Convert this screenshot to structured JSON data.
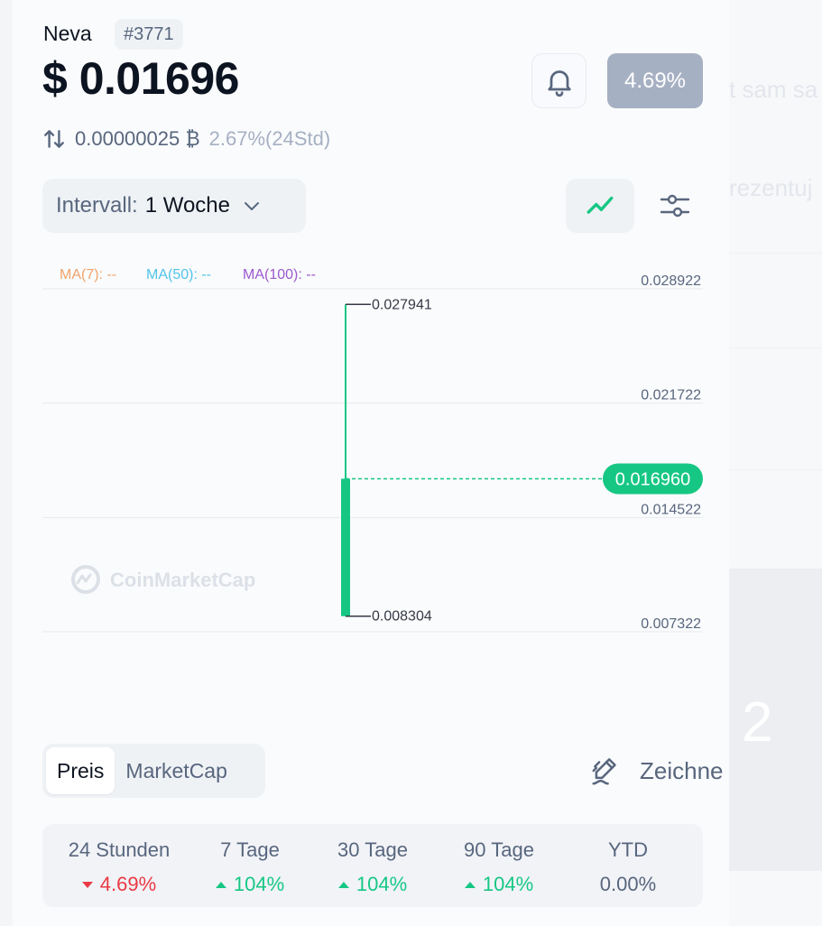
{
  "coin": {
    "name": "Neva",
    "rank": "#3771",
    "price": "$ 0.01696",
    "change_badge": "4.69%",
    "btc_price": "0.00000025 ₿",
    "btc_change": "2.67%(24Std)"
  },
  "controls": {
    "interval_label": "Intervall:",
    "interval_value": "1 Woche"
  },
  "chart_data": {
    "type": "candlestick",
    "indicators": [
      {
        "label": "MA(7): --",
        "color": "#f0a36a"
      },
      {
        "label": "MA(50): --",
        "color": "#4fc3e8"
      },
      {
        "label": "MA(100): --",
        "color": "#9b59d0"
      }
    ],
    "y_ticks": [
      "0.028922",
      "0.021722",
      "0.014522",
      "0.007322"
    ],
    "y_tick_values": [
      0.028922,
      0.021722,
      0.014522,
      0.007322
    ],
    "ylim": [
      0.007322,
      0.028922
    ],
    "candles": [
      {
        "open": 0.008304,
        "high": 0.027941,
        "low": 0.008304,
        "close": 0.01696
      }
    ],
    "high_label": "0.027941",
    "low_label": "0.008304",
    "current_price_label": "0.016960",
    "current_price": 0.01696,
    "watermark": "CoinMarketCap",
    "up_color": "#16c784"
  },
  "tabs": [
    "Preis",
    "MarketCap"
  ],
  "draw_label": "Zeichne",
  "performance": [
    {
      "label": "24 Stunden",
      "value": "4.69%",
      "dir": "down"
    },
    {
      "label": "7 Tage",
      "value": "104%",
      "dir": "up"
    },
    {
      "label": "30 Tage",
      "value": "104%",
      "dir": "up"
    },
    {
      "label": "90 Tage",
      "value": "104%",
      "dir": "up"
    },
    {
      "label": "YTD",
      "value": "0.00%",
      "dir": "none"
    }
  ],
  "background": {
    "ghost_1": "t sam sa",
    "ghost_2": "rezentuj",
    "big_digit": "2"
  }
}
